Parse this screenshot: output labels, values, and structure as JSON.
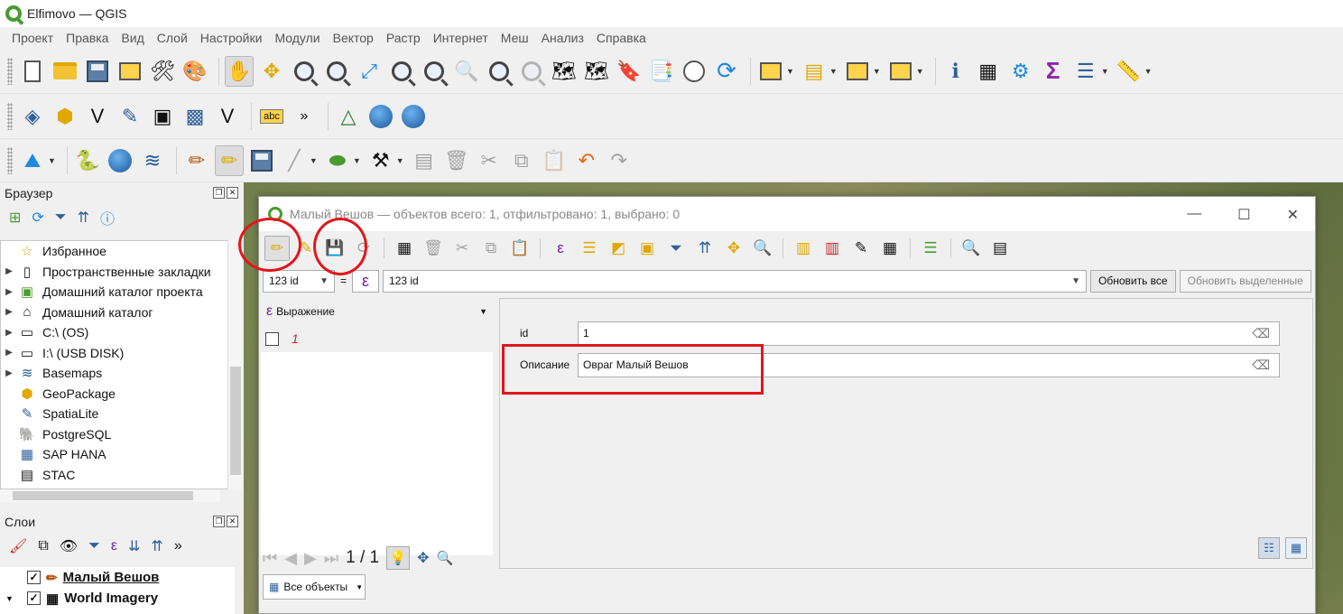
{
  "window": {
    "title": "Elfimovo — QGIS"
  },
  "menubar": [
    "Проект",
    "Правка",
    "Вид",
    "Слой",
    "Настройки",
    "Модули",
    "Вектор",
    "Растр",
    "Интернет",
    "Меш",
    "Анализ",
    "Справка"
  ],
  "browser_panel": {
    "title": "Браузер",
    "items": [
      {
        "label": "Избранное",
        "icon": "star-icon"
      },
      {
        "label": "Пространственные закладки",
        "icon": "bookmark-icon"
      },
      {
        "label": "Домашний каталог проекта",
        "icon": "project-home-icon"
      },
      {
        "label": "Домашний каталог",
        "icon": "home-folder-icon"
      },
      {
        "label": "C:\\ (OS)",
        "icon": "drive-icon"
      },
      {
        "label": "I:\\ (USB DISK)",
        "icon": "drive-icon"
      },
      {
        "label": "Basemaps",
        "icon": "basemaps-icon"
      },
      {
        "label": "GeoPackage",
        "icon": "geopackage-icon"
      },
      {
        "label": "SpatiaLite",
        "icon": "spatialite-icon"
      },
      {
        "label": "PostgreSQL",
        "icon": "postgresql-icon"
      },
      {
        "label": "SAP HANA",
        "icon": "sap-hana-icon"
      },
      {
        "label": "STAC",
        "icon": "stac-icon"
      }
    ]
  },
  "layers_panel": {
    "title": "Слои",
    "layers": [
      {
        "name": "Малый Вешов",
        "checked": true
      },
      {
        "name": "World Imagery",
        "checked": true
      }
    ]
  },
  "attribute_table": {
    "title": "Малый Вешов — объектов всего: 1, отфильтровано: 1, выбрано: 0",
    "field_combo": "123 id",
    "equals": "=",
    "expression_value": "123 id",
    "update_all_button": "Обновить все",
    "update_selected_button": "Обновить выделенные",
    "list_header": "Выражение",
    "feature_list": [
      "1"
    ],
    "counter": "1 / 1",
    "filter_combo": "Все объекты",
    "form": {
      "fields": [
        {
          "label": "id",
          "value": "1"
        },
        {
          "label": "Описание",
          "value": "Овраг Малый Вешов"
        }
      ]
    }
  },
  "colors": {
    "annotation_red": "#e3151a",
    "qgis_green": "#4a9b2f"
  }
}
